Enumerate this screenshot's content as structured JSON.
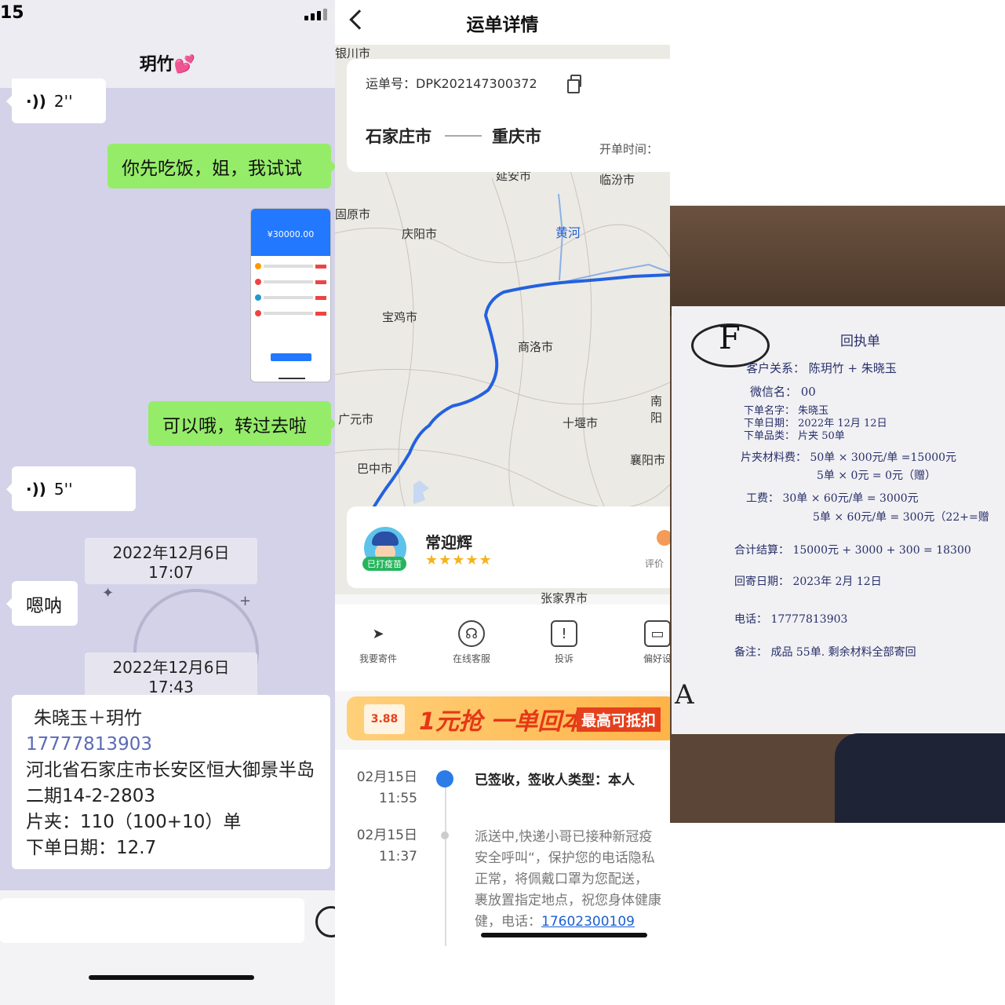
{
  "chat": {
    "status_time": "15",
    "contact_name": "玥竹💕",
    "messages": {
      "voice1": "2''",
      "out1": "你先吃饭，姐，我试试",
      "payment_amount": "¥30000.00",
      "out2": "可以哦，转过去啦",
      "voice2": "5''",
      "stamp1": "2022年12月6日 17:07",
      "in1": "嗯呐",
      "stamp2": "2022年12月6日 17:43"
    },
    "address_card": {
      "name": "朱晓玉＋玥竹",
      "phone": "17777813903",
      "address": "河北省石家庄市长安区恒大御景半岛二期14-2-2803",
      "quantity": "片夹：110（100+10）单",
      "order_date": "下单日期：12.7"
    }
  },
  "waybill": {
    "nav_title": "运单详情",
    "number": "运单号：DPK202147300372",
    "from_city": "石家庄市",
    "to_city": "重庆市",
    "open_time_label": "开单时间：",
    "map": {
      "cities": [
        "银川市",
        "延安市",
        "临汾市",
        "固原市",
        "庆阳市",
        "宝鸡市",
        "商洛市",
        "南阳",
        "十堰市",
        "广元市",
        "巴中市",
        "襄阳市",
        "张家界市"
      ],
      "river_label": "黄河"
    },
    "courier": {
      "name": "常迎辉",
      "badge": "已打疫苗",
      "stars": "★★★★★",
      "rate_label": "评价"
    },
    "actions": [
      {
        "label": "我要寄件",
        "icon": "send-icon"
      },
      {
        "label": "在线客服",
        "icon": "headset-icon"
      },
      {
        "label": "投诉",
        "icon": "complaint-icon"
      },
      {
        "label": "偏好设",
        "icon": "preference-icon"
      }
    ],
    "banner": {
      "coupon": "3.88",
      "headline": "1元抢 一单回本",
      "tag": "最高可抵扣"
    },
    "timeline": [
      {
        "date": "02月15日",
        "time": "11:55",
        "status": "已签收，签收人类型：本人"
      },
      {
        "date": "02月15日",
        "time": "11:37",
        "status": "派送中,快递小哥已接种新冠疫",
        "line2": "安全呼叫“，保护您的电话隐私",
        "line3": "正常，将佩戴口罩为您配送，",
        "line4": "裹放置指定地点，祝您身体健康",
        "line5": "健，电话：",
        "phone": "17602300109"
      }
    ]
  },
  "receipt": {
    "mark": "F",
    "title": "回执单",
    "lines": [
      "客户关系：  陈玥竹  +  朱晓玉",
      "微信名：  00",
      "下单名字：  朱晓玉",
      "下单日期：  2022年 12月 12日",
      "下单品类：  片夹 50单",
      "片夹材料费：  50单 × 300元/单  =15000元",
      "5单 × 0元  = 0元（赠）",
      "工费：  30单 × 60元/单  =  3000元",
      "5单 × 60元/单  =  300元（22+=赠",
      "合计结算：  15000元 + 3000 + 300  = 18300",
      "回寄日期：  2023年  2月  12日",
      "电话：  17777813903",
      "备注：  成品 55单.  剩余材料全部寄回"
    ],
    "corner_mark": "A"
  }
}
